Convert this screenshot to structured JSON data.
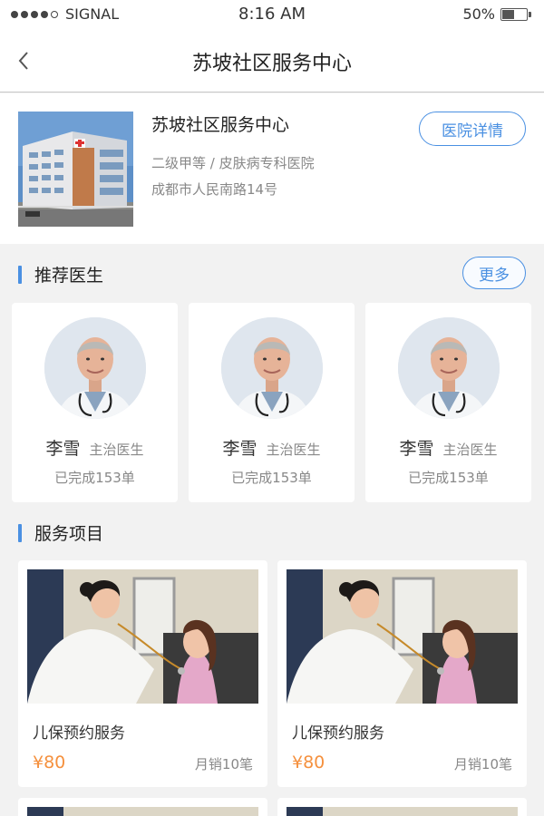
{
  "status_bar": {
    "carrier": "SIGNAL",
    "time": "8:16 AM",
    "battery": "50%",
    "battery_level": 0.5
  },
  "navbar": {
    "back_icon": "chevron-left-icon",
    "title": "苏坡社区服务中心"
  },
  "hospital": {
    "name": "苏坡社区服务中心",
    "level": "二级甲等 / 皮肤病专科医院",
    "address": "成都市人民南路14号",
    "detail_button": "医院详情"
  },
  "doctors_section": {
    "title": "推荐医生",
    "more_button": "更多",
    "doctors": [
      {
        "name": "李雪",
        "title": "主治医生",
        "completed": "已完成153单"
      },
      {
        "name": "李雪",
        "title": "主治医生",
        "completed": "已完成153单"
      },
      {
        "name": "李雪",
        "title": "主治医生",
        "completed": "已完成153单"
      }
    ]
  },
  "services_section": {
    "title": "服务项目",
    "services": [
      {
        "name": "儿保预约服务",
        "price": "¥80",
        "sales": "月销10笔"
      },
      {
        "name": "儿保预约服务",
        "price": "¥80",
        "sales": "月销10笔"
      }
    ]
  },
  "colors": {
    "accent": "#4a90e2",
    "price": "#f5903d",
    "background": "#f2f2f2"
  }
}
